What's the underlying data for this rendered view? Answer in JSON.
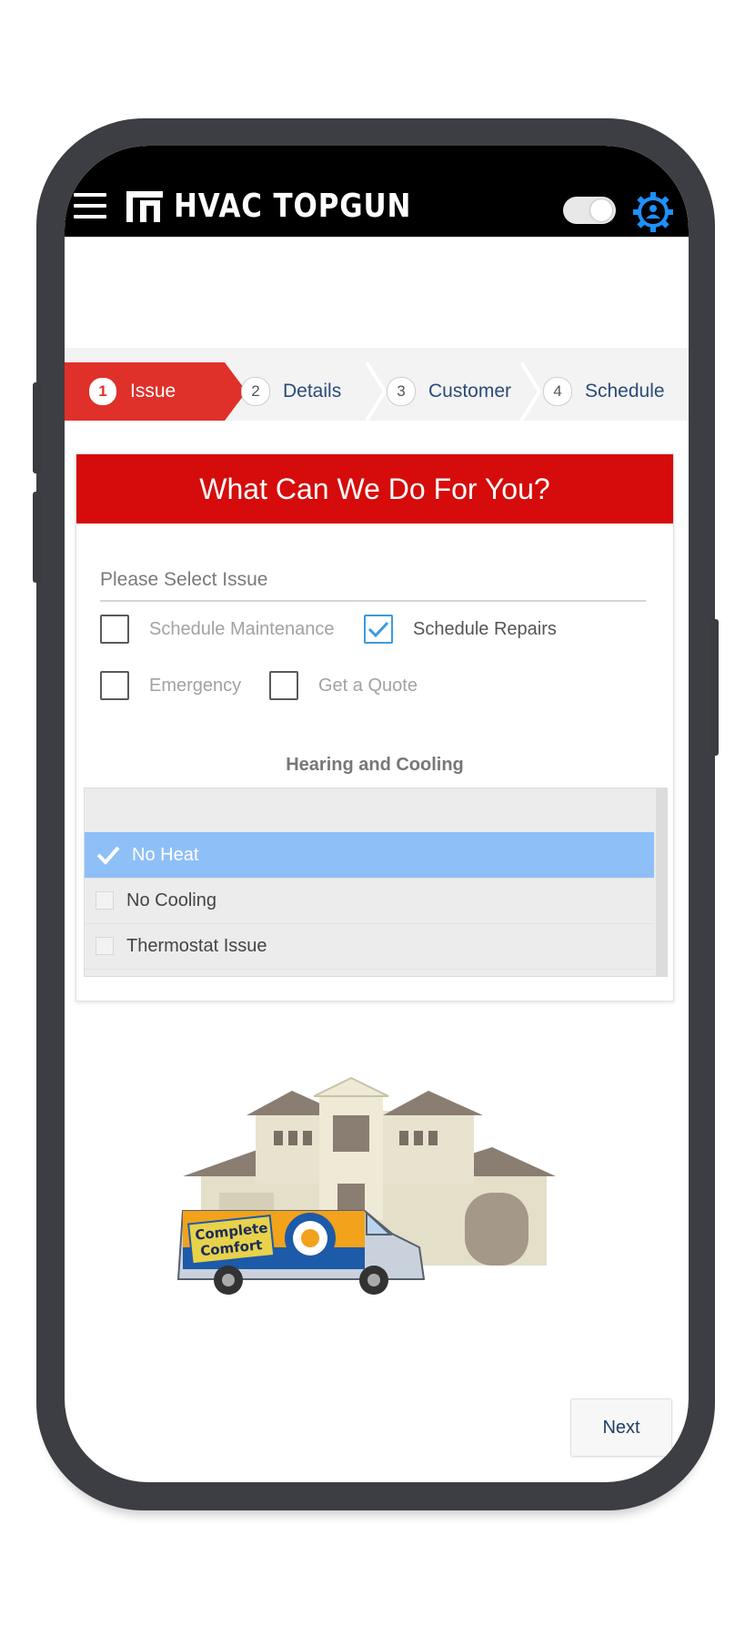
{
  "header": {
    "menu_icon": "hamburger-icon",
    "app_title": "HVAC TOPGUN",
    "theme_toggle": "toggle-switch",
    "account_icon": "user-gear-icon"
  },
  "stepper": {
    "steps": [
      {
        "number": "1",
        "label": "Issue",
        "active": true
      },
      {
        "number": "2",
        "label": "Details",
        "active": false
      },
      {
        "number": "3",
        "label": "Customer",
        "active": false
      },
      {
        "number": "4",
        "label": "Schedule",
        "active": false
      }
    ]
  },
  "card": {
    "title": "What Can We Do For You?",
    "field_label": "Please Select Issue",
    "options": [
      {
        "label": "Schedule Maintenance",
        "checked": false
      },
      {
        "label": "Schedule Repairs",
        "checked": true
      },
      {
        "label": "Emergency",
        "checked": false
      },
      {
        "label": "Get a Quote",
        "checked": false
      }
    ],
    "section_title": "Hearing and Cooling",
    "list": [
      {
        "label": "No Heat",
        "selected": true
      },
      {
        "label": "No Cooling",
        "selected": false
      },
      {
        "label": "Thermostat Issue",
        "selected": false
      }
    ]
  },
  "illustration": {
    "van_text_line1": "Complete",
    "van_text_line2": "Comfort"
  },
  "footer": {
    "next_label": "Next"
  },
  "colors": {
    "header_bg": "#000000",
    "accent_red": "#d60b0b",
    "step_active": "#e0302a",
    "selected_row": "#8ebff7",
    "checkbox_blue": "#3a9be0",
    "gear_blue": "#1e90ff"
  }
}
